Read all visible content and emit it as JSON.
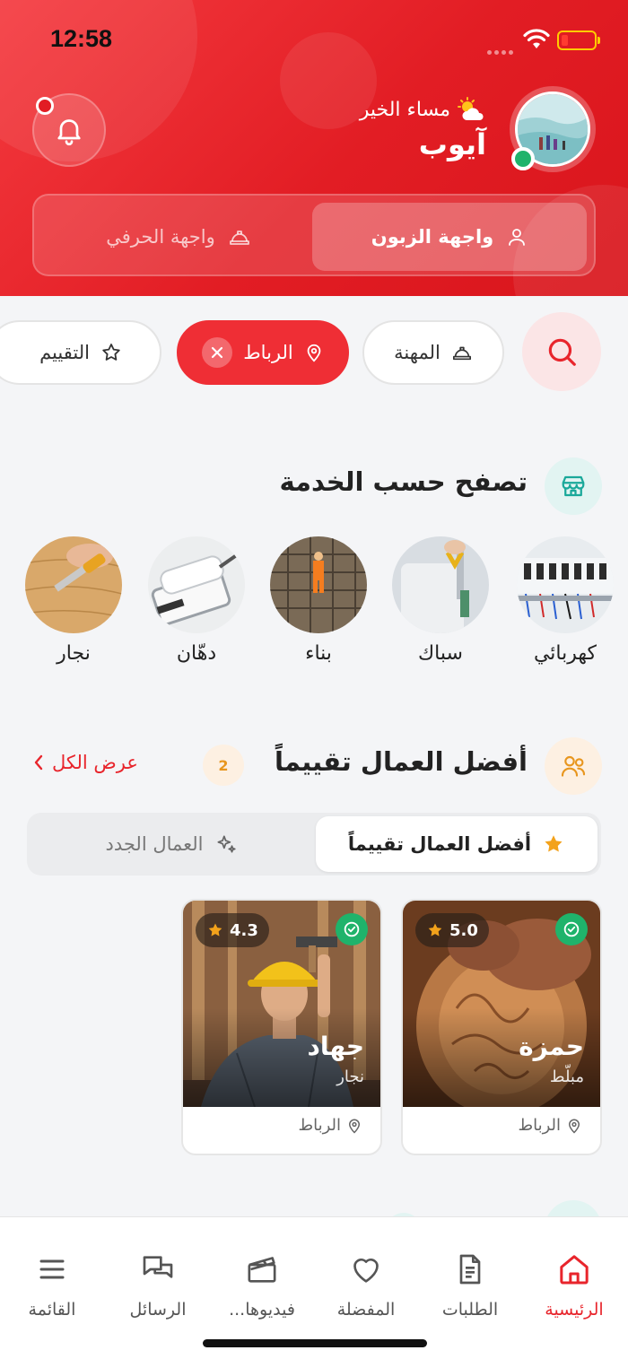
{
  "status_bar": {
    "time": "12:58"
  },
  "header": {
    "greeting": "مساء الخير",
    "greeting_icon": "sun-cloud-icon",
    "username": "آيوب",
    "modes": {
      "customer": "واجهة الزبون",
      "artisan": "واجهة الحرفي"
    },
    "colors": {
      "brand": "#e21d24",
      "online": "#1fb36b"
    }
  },
  "filters": {
    "profession": "المهنة",
    "location": "الرباط",
    "rating": "التقييم"
  },
  "browse_section": {
    "title": "تصفح حسب الخدمة",
    "categories": [
      {
        "label": "كهربائي"
      },
      {
        "label": "سباك"
      },
      {
        "label": "بناء"
      },
      {
        "label": "دهّان"
      },
      {
        "label": "نجار"
      }
    ]
  },
  "top_workers": {
    "title": "أفضل العمال تقييماً",
    "count": "2",
    "see_all": "عرض الكل",
    "tabs": {
      "top_rated": "أفضل العمال تقييماً",
      "new": "العمال الجدد"
    },
    "workers": [
      {
        "name": "حمزة",
        "job": "مبلّط",
        "rating": "5.0",
        "location": "الرباط"
      },
      {
        "name": "جهاد",
        "job": "نجار",
        "rating": "4.3",
        "location": "الرباط"
      }
    ]
  },
  "bottom_nav": {
    "home": "الرئيسية",
    "orders": "الطلبات",
    "favorites": "المفضلة",
    "videos": "فيديوها...",
    "messages": "الرسائل",
    "menu": "القائمة"
  }
}
